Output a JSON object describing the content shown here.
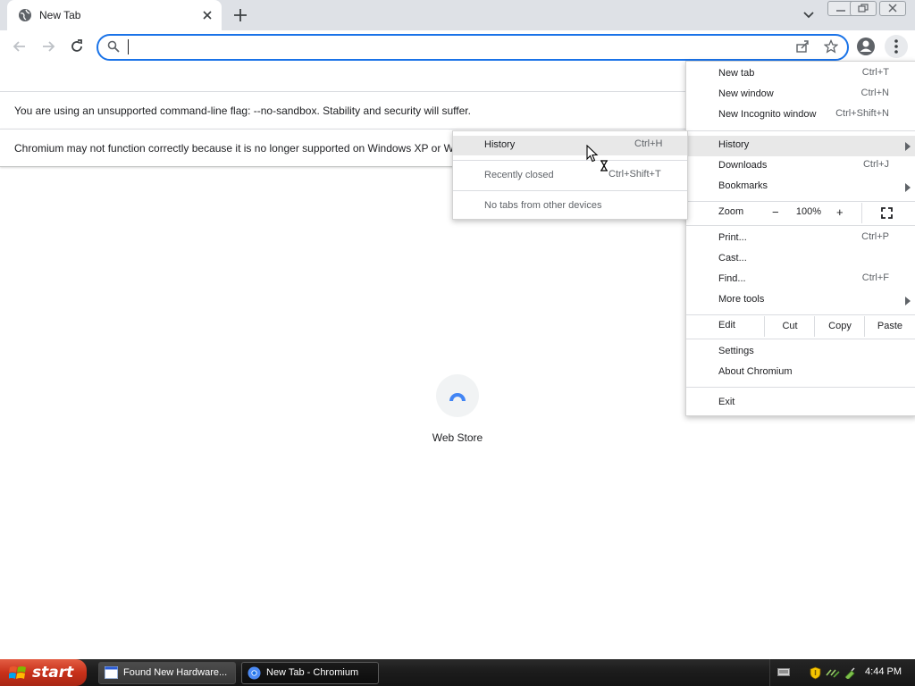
{
  "browser": {
    "tab": {
      "title": "New Tab"
    },
    "omnibox": {
      "value": "",
      "placeholder": ""
    }
  },
  "infobars": [
    "You are using an unsupported command-line flag: --no-sandbox. Stability and security will suffer.",
    "Chromium may not function correctly because it is no longer supported on Windows XP or W"
  ],
  "page": {
    "shortcut_label": "Web Store"
  },
  "main_menu": {
    "new_tab": {
      "label": "New tab",
      "shortcut": "Ctrl+T"
    },
    "new_window": {
      "label": "New window",
      "shortcut": "Ctrl+N"
    },
    "new_incognito": {
      "label": "New Incognito window",
      "shortcut": "Ctrl+Shift+N"
    },
    "history": {
      "label": "History"
    },
    "downloads": {
      "label": "Downloads",
      "shortcut": "Ctrl+J"
    },
    "bookmarks": {
      "label": "Bookmarks"
    },
    "zoom": {
      "label": "Zoom",
      "minus": "−",
      "value": "100%",
      "plus": "+"
    },
    "print": {
      "label": "Print...",
      "shortcut": "Ctrl+P"
    },
    "cast": {
      "label": "Cast..."
    },
    "find": {
      "label": "Find...",
      "shortcut": "Ctrl+F"
    },
    "more_tools": {
      "label": "More tools"
    },
    "edit": {
      "label": "Edit",
      "cut": "Cut",
      "copy": "Copy",
      "paste": "Paste"
    },
    "settings": {
      "label": "Settings"
    },
    "about": {
      "label": "About Chromium"
    },
    "exit": {
      "label": "Exit"
    }
  },
  "history_submenu": {
    "history": {
      "label": "History",
      "shortcut": "Ctrl+H"
    },
    "recently_closed": {
      "label": "Recently closed",
      "shortcut": "Ctrl+Shift+T"
    },
    "no_tabs": {
      "label": "No tabs from other devices"
    }
  },
  "taskbar": {
    "start_label": "start",
    "items": [
      "Found New Hardware...",
      "New Tab - Chromium"
    ],
    "clock": "4:44 PM"
  },
  "colors": {
    "accent": "#1a73e8",
    "tabstrip": "#dee1e6",
    "menu_highlight": "#e8e8e8",
    "start_button": "#c8311a"
  },
  "icons": [
    "globe-icon",
    "close-icon",
    "plus-icon",
    "chevron-down-icon",
    "back-arrow-icon",
    "forward-arrow-icon",
    "reload-icon",
    "search-icon",
    "share-icon",
    "star-icon",
    "profile-icon",
    "more-vert-icon",
    "fullscreen-icon",
    "chevron-right-icon",
    "windows-logo-icon",
    "chromium-icon"
  ]
}
